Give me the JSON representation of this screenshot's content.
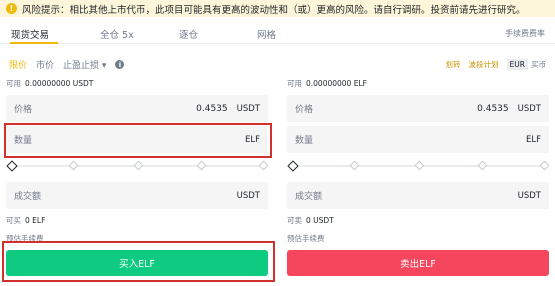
{
  "notice": {
    "text": "风险提示：相比其他上市代币，此项目可能具有更高的波动性和（或）更高的风险。请自行调研。投资前请先进行研究。"
  },
  "tabs": [
    {
      "label": "现货交易",
      "active": true
    },
    {
      "label": "全仓 5x",
      "active": false
    },
    {
      "label": "逐仓",
      "active": false
    },
    {
      "label": "网格",
      "active": false
    }
  ],
  "fee_link": "手续费费率",
  "order_types": {
    "limit": "限价",
    "market": "市价",
    "stop_limit": "止盈止损"
  },
  "right_links": {
    "transfer": "划转",
    "tutorial": "波段计划",
    "currency_a": "EUR",
    "currency_b": "买币"
  },
  "buy": {
    "avail_label": "可用",
    "avail_value": "0.00000000 USDT",
    "price_label": "价格",
    "price_value": "0.4535",
    "price_unit": "USDT",
    "amount_label": "数量",
    "amount_unit": "ELF",
    "total_label": "成交额",
    "total_unit": "USDT",
    "can_label": "可买",
    "can_value": "0 ELF",
    "fee_label": "预估手续费",
    "button": "买入ELF"
  },
  "sell": {
    "avail_label": "可用",
    "avail_value": "0.00000000 ELF",
    "price_label": "价格",
    "price_value": "0.4535",
    "price_unit": "USDT",
    "amount_label": "数量",
    "amount_unit": "ELF",
    "total_label": "成交额",
    "total_unit": "USDT",
    "can_label": "可卖",
    "can_value": "0 USDT",
    "fee_label": "预估手续费",
    "button": "卖出ELF"
  },
  "colors": {
    "accent": "#f0b90b",
    "buy": "#0ecb81",
    "sell": "#f6465d",
    "highlight": "#d2302c"
  }
}
